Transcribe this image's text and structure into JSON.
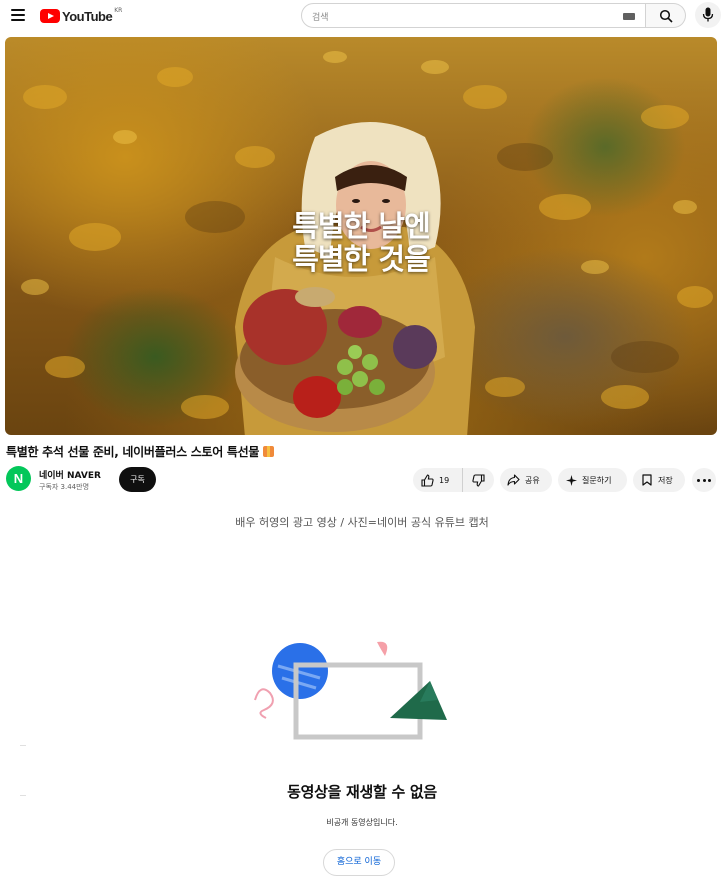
{
  "header": {
    "logo_text": "YouTube",
    "logo_country": "KR",
    "search_placeholder": "검색",
    "icons": [
      "menu-icon",
      "keyboard-icon",
      "search-icon",
      "mic-icon"
    ]
  },
  "video": {
    "overlay_line1": "특별한 날엔",
    "overlay_line2": "특별한 것을",
    "title": "특별한 추석 선물 준비, 네이버플러스 스토어 특선물",
    "title_icon": "gift-icon"
  },
  "channel": {
    "avatar_letter": "N",
    "avatar_color": "#03c75a",
    "name": "네이버 NAVER",
    "subscribers": "구독자 3.44만명",
    "subscribe_label": "구독"
  },
  "actions": {
    "like_count": "19",
    "share_label": "공유",
    "ask_label": "질문하기",
    "save_label": "저장"
  },
  "photo_caption": "배우 허영의 광고 영상 / 사진=네이버 공식 유튜브 캡처",
  "error": {
    "title": "동영상을 재생할 수 없음",
    "subtitle": "비공개 동영상입니다.",
    "home_button": "홈으로 이동"
  },
  "colors": {
    "brand_red": "#ff0000",
    "link_blue": "#065fd4"
  }
}
